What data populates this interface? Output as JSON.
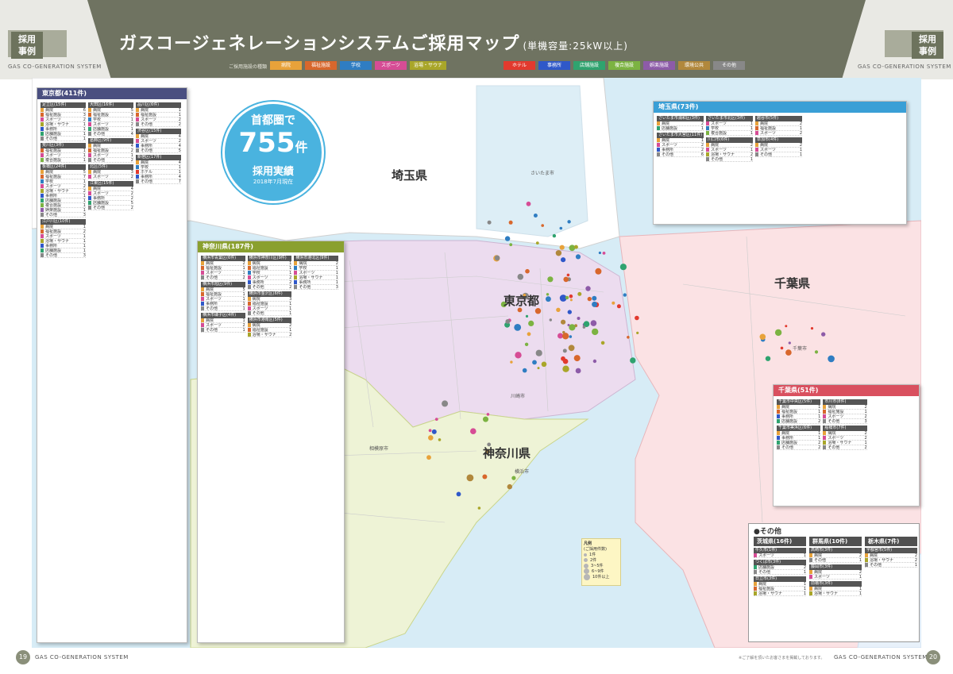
{
  "header": {
    "title": "ガスコージェネレーションシステムご採用マップ",
    "title_sub": "(単機容量:25kW以上)",
    "badge_line1": "採用",
    "badge_line2": "事例",
    "badge_sub": "GAS CO-GENERATION SYSTEM",
    "legend_caption": "ご採用施設の種類",
    "categories": [
      {
        "label": "病院",
        "color": "#e8a23a"
      },
      {
        "label": "福祉施設",
        "color": "#d8672c"
      },
      {
        "label": "学校",
        "color": "#2f7dc2"
      },
      {
        "label": "スポーツ",
        "color": "#d64c95"
      },
      {
        "label": "浴場・サウナ",
        "color": "#a9a629"
      },
      {
        "label": "ホテル",
        "color": "#e23a2e"
      },
      {
        "label": "事務所",
        "color": "#2f58c9"
      },
      {
        "label": "店舗施設",
        "color": "#2fa36f"
      },
      {
        "label": "複合施設",
        "color": "#7cb342"
      },
      {
        "label": "娯楽施設",
        "color": "#8d5ba8"
      },
      {
        "label": "環境公共",
        "color": "#b1883c"
      },
      {
        "label": "その他",
        "color": "#888888"
      }
    ]
  },
  "callout": {
    "line1": "首都圏で",
    "number": "755",
    "unit": "件",
    "line3": "採用実績",
    "line4": "2018年7月現在"
  },
  "map": {
    "prefectures": [
      "埼玉県",
      "東京都",
      "千葉県",
      "神奈川県"
    ],
    "cities": [
      "さいたま市",
      "川崎市",
      "横浜市",
      "千葉市",
      "相模原市"
    ],
    "legend": {
      "title": "凡例",
      "subtitle": "(ご採用件数)",
      "items": [
        "1件",
        "2件",
        "3~5件",
        "6~9件",
        "10件以上"
      ]
    }
  },
  "panels": {
    "tokyo": {
      "title": "東京都(411件)",
      "color": "#4a4f80",
      "wards": [
        {
          "name": "足立区(15件)",
          "rows": [
            [
              "病院",
              "6"
            ],
            [
              "福祉施設",
              "3"
            ],
            [
              "スポーツ",
              "2"
            ],
            [
              "浴場・サウナ",
              "1"
            ],
            [
              "事務所",
              "1"
            ],
            [
              "店舗施設",
              "1"
            ],
            [
              "その他",
              "1"
            ]
          ]
        },
        {
          "name": "荒川区(3件)",
          "rows": [
            [
              "福祉施設",
              "1"
            ],
            [
              "スポーツ",
              "1"
            ],
            [
              "複合施設",
              "1"
            ]
          ]
        },
        {
          "name": "板橋区(24件)",
          "rows": [
            [
              "病院",
              "5"
            ],
            [
              "福祉施設",
              "7"
            ],
            [
              "学校",
              "1"
            ],
            [
              "スポーツ",
              "2"
            ],
            [
              "浴場・サウナ",
              "2"
            ],
            [
              "事務所",
              "1"
            ],
            [
              "店舗施設",
              "1"
            ],
            [
              "複合施設",
              "1"
            ],
            [
              "娯楽施設",
              "1"
            ],
            [
              "その他",
              "3"
            ]
          ]
        },
        {
          "name": "江戸川区(10件)",
          "rows": [
            [
              "病院",
              "1"
            ],
            [
              "福祉施設",
              "2"
            ],
            [
              "スポーツ",
              "1"
            ],
            [
              "浴場・サウナ",
              "1"
            ],
            [
              "事務所",
              "1"
            ],
            [
              "店舗施設",
              "1"
            ],
            [
              "その他",
              "3"
            ]
          ]
        },
        {
          "name": "大田区(16件)",
          "rows": [
            [
              "病院",
              "5"
            ],
            [
              "福祉施設",
              "3"
            ],
            [
              "学校",
              "1"
            ],
            [
              "スポーツ",
              "2"
            ],
            [
              "店舗施設",
              "1"
            ],
            [
              "その他",
              "4"
            ]
          ]
        },
        {
          "name": "葛飾区(9件)",
          "rows": [
            [
              "病院",
              "4"
            ],
            [
              "福祉施設",
              "2"
            ],
            [
              "スポーツ",
              "1"
            ],
            [
              "その他",
              "2"
            ]
          ]
        },
        {
          "name": "北区(5件)",
          "rows": [
            [
              "病院",
              "3"
            ],
            [
              "スポーツ",
              "2"
            ]
          ]
        },
        {
          "name": "江東区(15件)",
          "rows": [
            [
              "病院",
              "4"
            ],
            [
              "スポーツ",
              "2"
            ],
            [
              "事務所",
              "2"
            ],
            [
              "店舗施設",
              "5"
            ],
            [
              "その他",
              "2"
            ]
          ]
        },
        {
          "name": "品川区(6件)",
          "rows": [
            [
              "病院",
              "1"
            ],
            [
              "福祉施設",
              "1"
            ],
            [
              "スポーツ",
              "2"
            ],
            [
              "その他",
              "2"
            ]
          ]
        },
        {
          "name": "渋谷区(15件)",
          "rows": [
            [
              "病院",
              "4"
            ],
            [
              "スポーツ",
              "2"
            ],
            [
              "事務所",
              "4"
            ],
            [
              "その他",
              "5"
            ]
          ]
        },
        {
          "name": "新宿区(17件)",
          "rows": [
            [
              "病院",
              "4"
            ],
            [
              "学校",
              "1"
            ],
            [
              "ホテル",
              "1"
            ],
            [
              "事務所",
              "4"
            ],
            [
              "その他",
              "7"
            ]
          ]
        }
      ]
    },
    "kanagawa": {
      "title": "神奈川県(187件)",
      "color": "#8aa02f",
      "wards": [
        {
          "name": "横浜市青葉区(6件)",
          "rows": [
            [
              "病院",
              "2"
            ],
            [
              "福祉施設",
              "1"
            ],
            [
              "スポーツ",
              "1"
            ],
            [
              "その他",
              "2"
            ]
          ]
        },
        {
          "name": "横浜市旭区(9件)",
          "rows": [
            [
              "病院",
              "5"
            ],
            [
              "福祉施設",
              "1"
            ],
            [
              "スポーツ",
              "1"
            ],
            [
              "事務所",
              "1"
            ],
            [
              "その他",
              "1"
            ]
          ]
        },
        {
          "name": "横浜市磯子区(4件)",
          "rows": [
            [
              "病院",
              "1"
            ],
            [
              "スポーツ",
              "2"
            ],
            [
              "その他",
              "1"
            ]
          ]
        },
        {
          "name": "横浜市神奈川区(9件)",
          "rows": [
            [
              "病院",
              "1"
            ],
            [
              "福祉施設",
              "1"
            ],
            [
              "学校",
              "1"
            ],
            [
              "スポーツ",
              "2"
            ],
            [
              "事務所",
              "2"
            ],
            [
              "その他",
              "2"
            ]
          ]
        },
        {
          "name": "横浜市金沢区(6件)",
          "rows": [
            [
              "病院",
              "3"
            ],
            [
              "福祉施設",
              "1"
            ],
            [
              "スポーツ",
              "1"
            ],
            [
              "その他",
              "1"
            ]
          ]
        },
        {
          "name": "横浜市港南区(5件)",
          "rows": [
            [
              "病院",
              "2"
            ],
            [
              "福祉施設",
              "1"
            ],
            [
              "浴場・サウナ",
              "2"
            ]
          ]
        },
        {
          "name": "横浜市港北区(9件)",
          "rows": [
            [
              "病院",
              "2"
            ],
            [
              "学校",
              "1"
            ],
            [
              "スポーツ",
              "1"
            ],
            [
              "浴場・サウナ",
              "1"
            ],
            [
              "事務所",
              "1"
            ],
            [
              "その他",
              "3"
            ]
          ]
        }
      ]
    },
    "saitama": {
      "title": "埼玉県(73件)",
      "color": "#3a9fd6",
      "wards": [
        {
          "name": "さいたま市浦和区(3件)",
          "rows": [
            [
              "病院",
              "2"
            ],
            [
              "店舗施設",
              "1"
            ]
          ]
        },
        {
          "name": "さいたま市大宮区(11件)",
          "rows": [
            [
              "病院",
              "1"
            ],
            [
              "スポーツ",
              "2"
            ],
            [
              "事務所",
              "2"
            ],
            [
              "その他",
              "6"
            ]
          ]
        },
        {
          "name": "さいたま市北区(3件)",
          "rows": [
            [
              "スポーツ",
              "1"
            ],
            [
              "学校",
              "1"
            ],
            [
              "複合施設",
              "1"
            ]
          ]
        },
        {
          "name": "川口市(6件)",
          "rows": [
            [
              "病院",
              "2"
            ],
            [
              "スポーツ",
              "1"
            ],
            [
              "浴場・サウナ",
              "2"
            ],
            [
              "その他",
              "1"
            ]
          ]
        },
        {
          "name": "越谷市(5件)",
          "rows": [
            [
              "病院",
              "2"
            ],
            [
              "福祉施設",
              "1"
            ],
            [
              "スポーツ",
              "2"
            ]
          ]
        },
        {
          "name": "草加市(4件)",
          "rows": [
            [
              "病院",
              "2"
            ],
            [
              "スポーツ",
              "1"
            ],
            [
              "その他",
              "1"
            ]
          ]
        }
      ]
    },
    "chiba": {
      "title": "千葉県(51件)",
      "color": "#d9505f",
      "wards": [
        {
          "name": "千葉市中央区(5件)",
          "rows": [
            [
              "病院",
              "1"
            ],
            [
              "福祉施設",
              "1"
            ],
            [
              "事務所",
              "1"
            ],
            [
              "店舗施設",
              "2"
            ]
          ]
        },
        {
          "name": "千葉市美浜区(6件)",
          "rows": [
            [
              "病院",
              "1"
            ],
            [
              "事務所",
              "1"
            ],
            [
              "店舗施設",
              "2"
            ],
            [
              "その他",
              "2"
            ]
          ]
        },
        {
          "name": "市川市(8件)",
          "rows": [
            [
              "病院",
              "2"
            ],
            [
              "福祉施設",
              "1"
            ],
            [
              "スポーツ",
              "2"
            ],
            [
              "その他",
              "3"
            ]
          ]
        },
        {
          "name": "船橋市(7件)",
          "rows": [
            [
              "病院",
              "2"
            ],
            [
              "スポーツ",
              "2"
            ],
            [
              "浴場・サウナ",
              "1"
            ],
            [
              "その他",
              "2"
            ]
          ]
        }
      ]
    }
  },
  "other": {
    "title": "●その他",
    "prefs": [
      {
        "title": "茨城県(16件)",
        "rows": [
          [
            "牛久市(1件)",
            ""
          ],
          [
            "スポーツ",
            "1"
          ],
          [
            "つくば市(3件)",
            ""
          ],
          [
            "店舗施設",
            "2"
          ],
          [
            "その他",
            "1"
          ],
          [
            "日立市(3件)",
            ""
          ],
          [
            "病院",
            "1"
          ],
          [
            "福祉施設",
            "1"
          ],
          [
            "浴場・サウナ",
            "1"
          ]
        ]
      },
      {
        "title": "群馬県(10件)",
        "rows": [
          [
            "高崎市(3件)",
            ""
          ],
          [
            "病院",
            "2"
          ],
          [
            "その他",
            "1"
          ],
          [
            "藤岡市(3件)",
            ""
          ],
          [
            "病院",
            "2"
          ],
          [
            "スポーツ",
            "1"
          ],
          [
            "前橋市(3件)",
            ""
          ],
          [
            "病院",
            "1"
          ],
          [
            "浴場・サウナ",
            "1"
          ]
        ]
      },
      {
        "title": "栃木県(7件)",
        "rows": [
          [
            "宇都宮市(5件)",
            ""
          ],
          [
            "病院",
            "2"
          ],
          [
            "浴場・サウナ",
            "2"
          ],
          [
            "その他",
            "1"
          ]
        ]
      }
    ]
  },
  "footer": {
    "left_page": "19",
    "right_page": "20",
    "text": "GAS CO-GENERATION SYSTEM",
    "note": "※ご了解を頂いたお客さまを掲載しております。"
  }
}
